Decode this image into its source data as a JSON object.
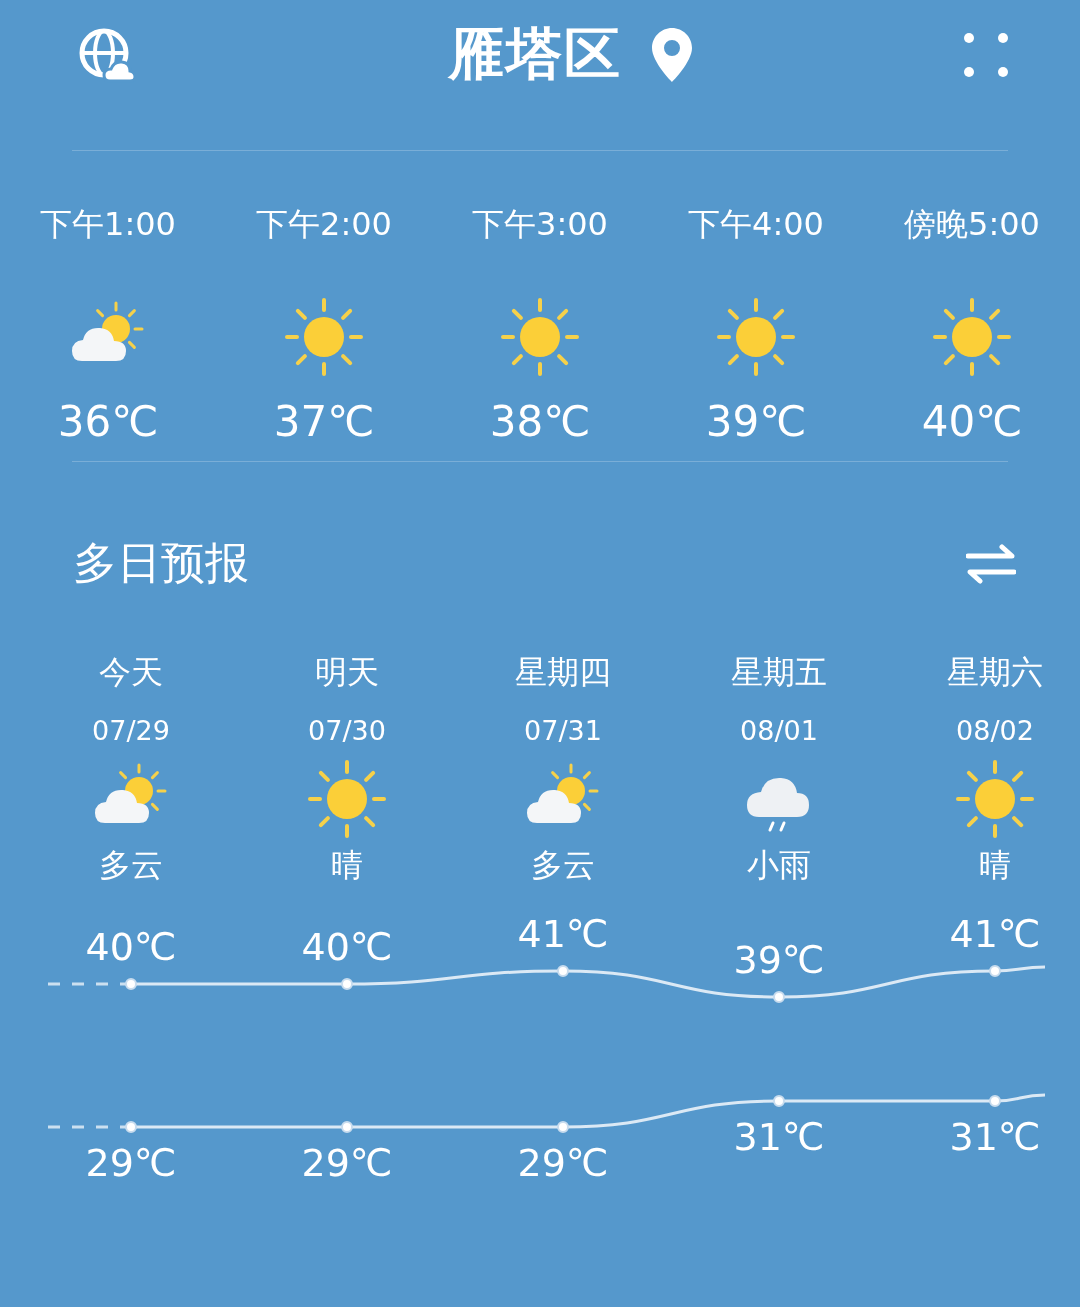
{
  "header": {
    "city": "雁塔区"
  },
  "hourly": [
    {
      "time": "下午1:00",
      "kind": "partly_cloudy",
      "temp": "36℃"
    },
    {
      "time": "下午2:00",
      "kind": "sunny",
      "temp": "37℃"
    },
    {
      "time": "下午3:00",
      "kind": "sunny",
      "temp": "38℃"
    },
    {
      "time": "下午4:00",
      "kind": "sunny",
      "temp": "39℃"
    },
    {
      "time": "傍晚5:00",
      "kind": "sunny",
      "temp": "40℃"
    }
  ],
  "forecast": {
    "title": "多日预报",
    "days": [
      {
        "day": "今天",
        "date": "07/29",
        "kind": "partly_cloudy",
        "label": "多云",
        "high": "40℃",
        "low": "29℃"
      },
      {
        "day": "明天",
        "date": "07/30",
        "kind": "sunny",
        "label": "晴",
        "high": "40℃",
        "low": "29℃"
      },
      {
        "day": "星期四",
        "date": "07/31",
        "kind": "partly_cloudy",
        "label": "多云",
        "high": "41℃",
        "low": "29℃"
      },
      {
        "day": "星期五",
        "date": "08/01",
        "kind": "rain",
        "label": "小雨",
        "high": "39℃",
        "low": "31℃"
      },
      {
        "day": "星期六",
        "date": "08/02",
        "kind": "sunny",
        "label": "晴",
        "high": "41℃",
        "low": "31℃"
      }
    ]
  }
}
